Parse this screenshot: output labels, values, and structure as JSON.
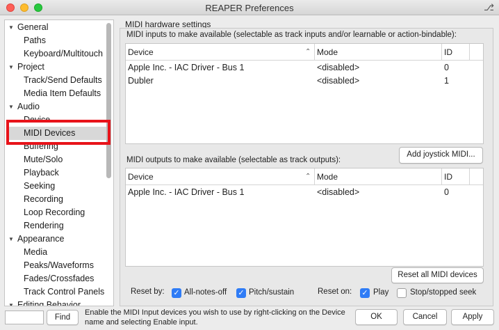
{
  "window": {
    "title": "REAPER Preferences"
  },
  "tree": {
    "items": [
      {
        "label": "General",
        "level": 0,
        "expanded": true
      },
      {
        "label": "Paths",
        "level": 1
      },
      {
        "label": "Keyboard/Multitouch",
        "level": 1
      },
      {
        "label": "Project",
        "level": 0,
        "expanded": true
      },
      {
        "label": "Track/Send Defaults",
        "level": 1
      },
      {
        "label": "Media Item Defaults",
        "level": 1
      },
      {
        "label": "Audio",
        "level": 0,
        "expanded": true
      },
      {
        "label": "Device",
        "level": 1
      },
      {
        "label": "MIDI Devices",
        "level": 1,
        "selected": true
      },
      {
        "label": "Buffering",
        "level": 1
      },
      {
        "label": "Mute/Solo",
        "level": 1
      },
      {
        "label": "Playback",
        "level": 1
      },
      {
        "label": "Seeking",
        "level": 1
      },
      {
        "label": "Recording",
        "level": 1
      },
      {
        "label": "Loop Recording",
        "level": 1
      },
      {
        "label": "Rendering",
        "level": 1
      },
      {
        "label": "Appearance",
        "level": 0,
        "expanded": true
      },
      {
        "label": "Media",
        "level": 1
      },
      {
        "label": "Peaks/Waveforms",
        "level": 1
      },
      {
        "label": "Fades/Crossfades",
        "level": 1
      },
      {
        "label": "Track Control Panels",
        "level": 1
      },
      {
        "label": "Editing Behavior",
        "level": 0,
        "expanded": true
      }
    ]
  },
  "panel": {
    "title": "MIDI hardware settings",
    "inputs_label": "MIDI inputs to make available (selectable as track inputs and/or learnable or action-bindable):",
    "outputs_label": "MIDI outputs to make available (selectable as track outputs):",
    "columns": {
      "device": "Device",
      "mode": "Mode",
      "id": "ID"
    },
    "inputs": [
      {
        "device": "Apple Inc. - IAC Driver - Bus 1",
        "mode": "<disabled>",
        "id": "0"
      },
      {
        "device": "Dubler",
        "mode": "<disabled>",
        "id": "1"
      }
    ],
    "outputs": [
      {
        "device": "Apple Inc. - IAC Driver - Bus 1",
        "mode": "<disabled>",
        "id": "0"
      }
    ],
    "add_joystick_label": "Add joystick MIDI...",
    "reset_all_label": "Reset all MIDI devices",
    "reset_by_label": "Reset by:",
    "all_notes_off_label": "All-notes-off",
    "all_notes_off_checked": true,
    "pitch_sustain_label": "Pitch/sustain",
    "pitch_sustain_checked": true,
    "reset_on_label": "Reset on:",
    "play_label": "Play",
    "play_checked": true,
    "stop_seek_label": "Stop/stopped seek",
    "stop_seek_checked": false
  },
  "footer": {
    "find_label": "Find",
    "find_value": "",
    "help_text": "Enable the MIDI Input devices you wish to use by right-clicking on the Device name and selecting Enable input.",
    "ok_label": "OK",
    "cancel_label": "Cancel",
    "apply_label": "Apply"
  },
  "icons": {
    "pin": "pin-icon",
    "sort": "sort-ascending-icon",
    "check": "checkmark-icon",
    "expand": "triangle-down-icon"
  },
  "colors": {
    "accent": "#2f7cf6",
    "highlight_box": "#e8131a",
    "selected_row": "#d8d8d8"
  }
}
